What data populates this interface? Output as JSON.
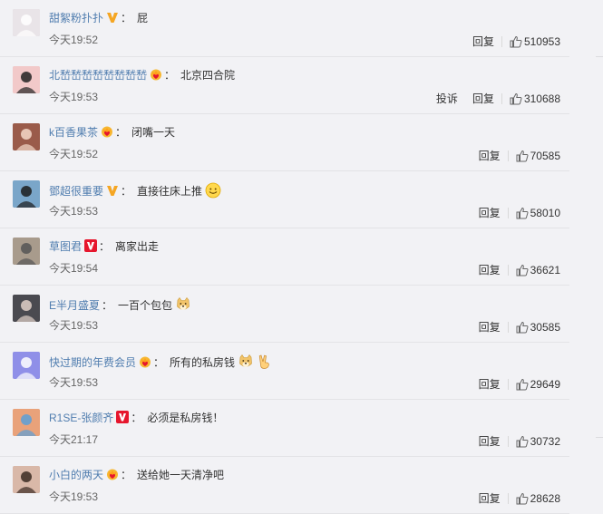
{
  "actions": {
    "reply": "回复",
    "report": "投诉"
  },
  "colors": {
    "username": "#507daf",
    "badge_gold": "#f5a623",
    "badge_red": "#e6162d",
    "background": "#f2f2f5"
  },
  "comments": [
    {
      "user": "甜絮粉扑扑",
      "badge": "v-gold-icon",
      "text": "屁",
      "emoji": [],
      "time": "今天19:52",
      "likes": "510953",
      "show_report": false,
      "avatar_color": "#e9e4e8"
    },
    {
      "user": "北嵆嵆嵆嵆嵆嵆嵆嵆",
      "badge": "crown-heart-icon",
      "text": "北京四合院",
      "emoji": [],
      "time": "今天19:53",
      "likes": "310688",
      "show_report": true,
      "avatar_color": "#f2c9c9"
    },
    {
      "user": "k百香果茶",
      "badge": "crown-heart-icon",
      "text": "闭嘴一天",
      "emoji": [],
      "time": "今天19:52",
      "likes": "70585",
      "show_report": false,
      "avatar_color": "#9a5b4a"
    },
    {
      "user": "鄧超很重要",
      "badge": "v-gold-icon",
      "text": "直接往床上推",
      "emoji": [
        "smile-emoji"
      ],
      "time": "今天19:53",
      "likes": "58010",
      "show_report": false,
      "avatar_color": "#7aa6c9"
    },
    {
      "user": "草图君",
      "badge": "v-red-icon",
      "text": "离家出走",
      "emoji": [],
      "time": "今天19:54",
      "likes": "36621",
      "show_report": false,
      "avatar_color": "#a89b8c"
    },
    {
      "user": "E半月盛夏",
      "badge": "",
      "text": "一百个包包",
      "emoji": [
        "doge-emoji"
      ],
      "time": "今天19:53",
      "likes": "30585",
      "show_report": false,
      "avatar_color": "#4a4a50"
    },
    {
      "user": "快过期的年费会员",
      "badge": "crown-heart-icon",
      "text": "所有的私房钱",
      "emoji": [
        "doge-emoji",
        "victory-hand-emoji"
      ],
      "time": "今天19:53",
      "likes": "29649",
      "show_report": false,
      "avatar_color": "#8f8fe8"
    },
    {
      "user": "R1SE-张颜齐",
      "badge": "v-red-icon",
      "text": "必须是私房钱！",
      "emoji": [],
      "time": "今天21:17",
      "likes": "30732",
      "show_report": false,
      "avatar_color": "#e9a27a"
    },
    {
      "user": "小白的两天",
      "badge": "crown-heart-icon",
      "text": "送给她一天清净吧",
      "emoji": [],
      "time": "今天19:53",
      "likes": "28628",
      "show_report": false,
      "avatar_color": "#d9b8a8"
    }
  ]
}
